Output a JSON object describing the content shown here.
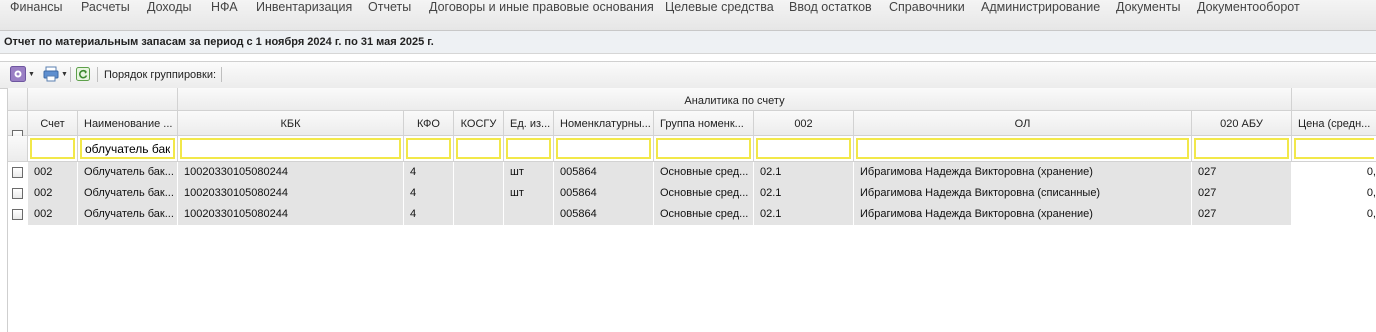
{
  "menu": [
    "Финансы",
    "Расчеты",
    "Доходы",
    "НФА",
    "Инвентаризация",
    "Отчеты",
    "Договоры и иные правовые основания",
    "Целевые средства",
    "Ввод остатков",
    "Справочники",
    "Администрирование",
    "Документы",
    "Документооборот"
  ],
  "report": {
    "title": "Отчет по материальным запасам за период с 1 ноября 2024 г. по 31 мая 2025 г."
  },
  "toolbar": {
    "grouping_label": "Порядок группировки:"
  },
  "grid": {
    "group_header": "Аналитика по счету",
    "columns": [
      "Счет",
      "Наименование ...",
      "КБК",
      "КФО",
      "КОСГУ",
      "Ед. из...",
      "Номенклатурны...",
      "Группа номенк...",
      "002",
      "ОЛ",
      "020 АБУ",
      "Цена (средн..."
    ],
    "filters": [
      "",
      "облучатель бак",
      "",
      "",
      "",
      "",
      "",
      "",
      "",
      "",
      "",
      ""
    ],
    "rows": [
      [
        "002",
        "Облучатель бак...",
        "10020330105080244",
        "4",
        "",
        "шт",
        "005864",
        "Основные сред...",
        "02.1",
        "Ибрагимова Надежда Викторовна (хранение)",
        "027",
        "0,"
      ],
      [
        "002",
        "Облучатель бак...",
        "10020330105080244",
        "4",
        "",
        "шт",
        "005864",
        "Основные сред...",
        "02.1",
        "Ибрагимова Надежда Викторовна (списанные)",
        "027",
        "0,"
      ],
      [
        "002",
        "Облучатель бак...",
        "10020330105080244",
        "4",
        "",
        "",
        "005864",
        "Основные сред...",
        "02.1",
        "Ибрагимова Надежда Викторовна (хранение)",
        "027",
        "0,"
      ]
    ]
  },
  "icons": [
    "settings-icon",
    "print-icon",
    "refresh-icon"
  ]
}
